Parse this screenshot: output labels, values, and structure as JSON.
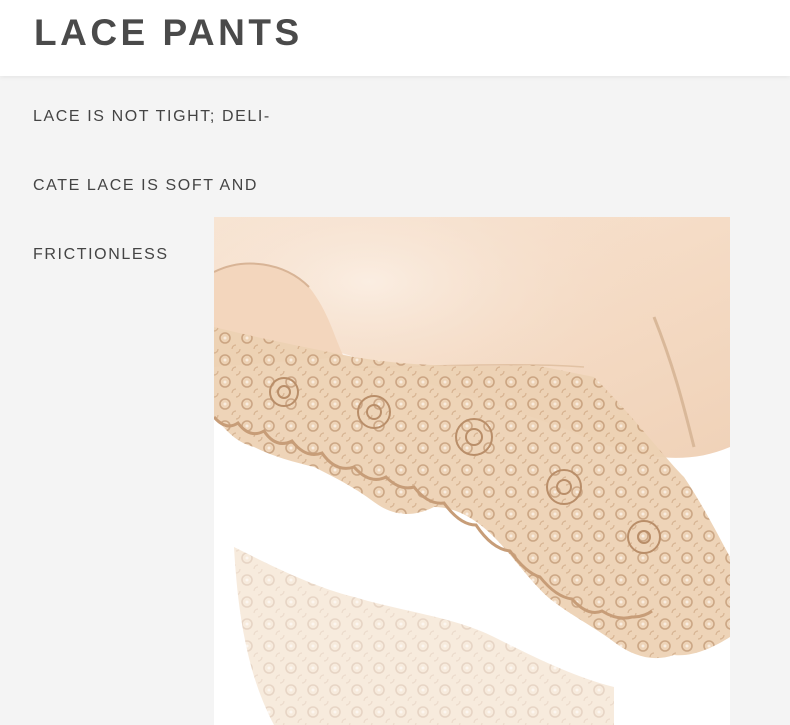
{
  "header": {
    "title": "LACE PANTS"
  },
  "description": {
    "lines": [
      "LACE IS NOT TIGHT; DELI-",
      "CATE LACE IS SOFT AND",
      "FRICTIONLESS"
    ]
  },
  "photo": {
    "subject": "lace-trimmed-fabric-closeup",
    "colors": {
      "fabric": "#f6dfcb",
      "lace": "#e8c7a6",
      "background": "#ffffff"
    }
  }
}
